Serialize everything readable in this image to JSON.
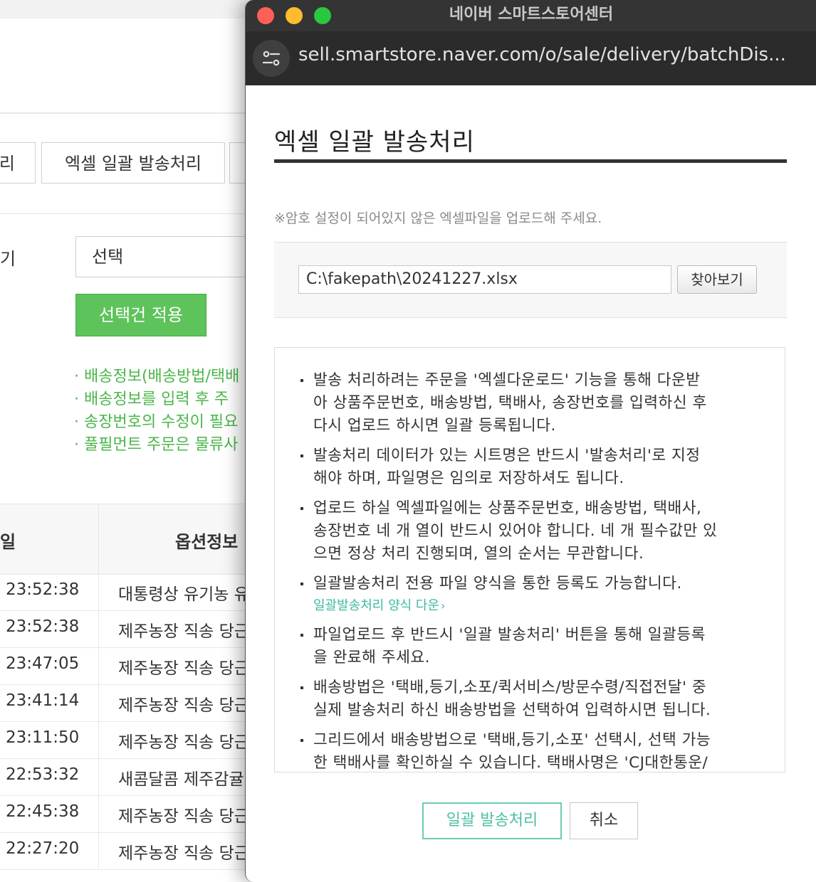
{
  "background_page": {
    "tabs": [
      "리",
      "엑셀 일괄 발송처리",
      ""
    ],
    "filter_label": "기",
    "select_value": "선택",
    "apply_button": "선택건 적용",
    "notes": [
      "· 배송정보(배송방법/택배",
      "· 배송정보를 입력 후 주",
      "· 송장번호의 수정이 필요",
      "· 풀필먼트 주문은 물류사"
    ],
    "table": {
      "headers": [
        "일",
        "옵션정보"
      ],
      "rows": [
        {
          "time": "23:52:38",
          "option": "대통령상 유기농 유"
        },
        {
          "time": "23:52:38",
          "option": "제주농장 직송 당근"
        },
        {
          "time": "23:47:05",
          "option": "제주농장 직송 당근"
        },
        {
          "time": "23:41:14",
          "option": "제주농장 직송 당근"
        },
        {
          "time": "23:11:50",
          "option": "제주농장 직송 당근"
        },
        {
          "time": "22:53:32",
          "option": "새콤달콤 제주감귤"
        },
        {
          "time": "22:45:38",
          "option": "제주농장 직송 당근"
        },
        {
          "time": "22:27:20",
          "option": "제주농장 직송 당근"
        }
      ]
    }
  },
  "popup": {
    "window_title": "네이버 스마트스토어센터",
    "url": "sell.smartstore.naver.com/o/sale/delivery/batchDis...",
    "heading": "엑셀 일괄 발송처리",
    "notice": "※암호 설정이 되어있지 않은 엑셀파일을 업로드해 주세요.",
    "file_value": "C:\\fakepath\\20241227.xlsx",
    "browse_label": "찾아보기",
    "guides": [
      "발송 처리하려는 주문을 '엑셀다운로드' 기능을 통해 다운받\n아 상품주문번호, 배송방법, 택배사, 송장번호를 입력하신 후\n다시 업로드 하시면 일괄 등록됩니다.",
      "발송처리 데이터가 있는 시트명은 반드시 '발송처리'로 지정\n해야 하며, 파일명은 임의로 저장하셔도 됩니다.",
      "업로드 하실 엑셀파일에는 상품주문번호, 배송방법, 택배사,\n송장번호 네 개 열이 반드시 있어야 합니다. 네 개 필수값만 있\n으면 정상 처리 진행되며, 열의 순서는 무관합니다.",
      "일괄발송처리 전용 파일 양식을 통한 등록도 가능합니다.",
      "파일업로드 후 반드시 '일괄 발송처리' 버튼을 통해 일괄등록\n을 완료해 주세요.",
      "배송방법은 '택배,등기,소포/퀵서비스/방문수령/직접전달' 중\n실제 발송처리 하신 배송방법을 선택하여 입력하시면 됩니다.",
      "그리드에서 배송방법으로 '택배,등기,소포' 선택시, 선택 가능\n한 택배사를 확인하실 수 있습니다. 택배사명은 'CJ대한통운/"
    ],
    "template_link": "일괄발송처리 양식 다운",
    "submit_label": "일괄 발송처리",
    "cancel_label": "취소",
    "colors": {
      "accent": "#4fbea4",
      "bg_green": "#5dc35a",
      "titlebar": "#343434"
    }
  }
}
